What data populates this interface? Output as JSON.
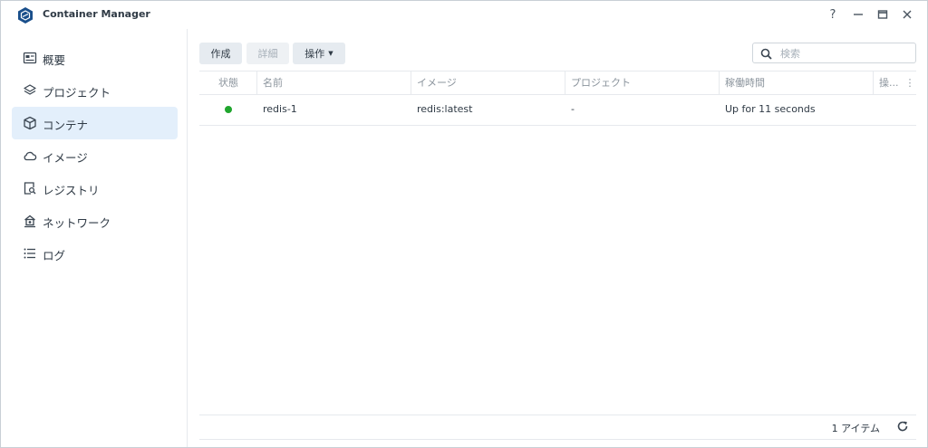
{
  "window": {
    "title": "Container Manager",
    "controls": [
      "help-icon",
      "minimize-icon",
      "maximize-icon",
      "close-icon"
    ],
    "help_label": "?",
    "brand_color": "#1a4f8b"
  },
  "sidebar": {
    "items": [
      {
        "label": "概要",
        "icon": "overview-icon",
        "active": false
      },
      {
        "label": "プロジェクト",
        "icon": "layers-icon",
        "active": false
      },
      {
        "label": "コンテナ",
        "icon": "cube-icon",
        "active": true
      },
      {
        "label": "イメージ",
        "icon": "cloud-icon",
        "active": false
      },
      {
        "label": "レジストリ",
        "icon": "registry-search-icon",
        "active": false
      },
      {
        "label": "ネットワーク",
        "icon": "network-icon",
        "active": false
      },
      {
        "label": "ログ",
        "icon": "list-icon",
        "active": false
      }
    ]
  },
  "toolbar": {
    "create_label": "作成",
    "details_label": "詳細",
    "action_label": "操作",
    "search_placeholder": "検索",
    "search_value": ""
  },
  "table": {
    "headers": [
      "状態",
      "名前",
      "イメージ",
      "プロジェクト",
      "稼働時間",
      "操..."
    ],
    "rows": [
      {
        "status": "running",
        "status_color": "#20a52e",
        "name": "redis-1",
        "image": "redis:latest",
        "project": "-",
        "uptime": "Up for 11 seconds"
      }
    ]
  },
  "footer": {
    "item_count": "1 アイテム"
  }
}
